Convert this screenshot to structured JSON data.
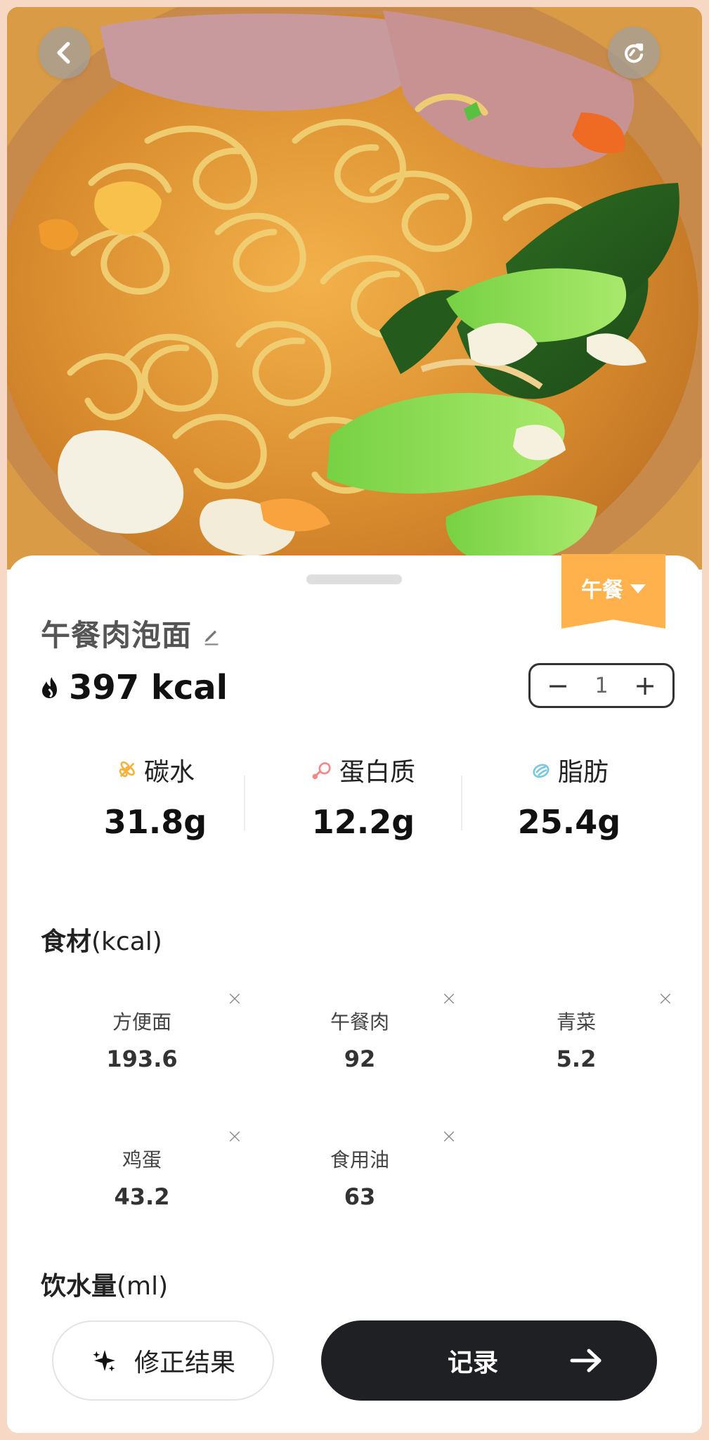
{
  "food": {
    "name": "午餐肉泡面",
    "calories": "397 kcal",
    "meal": "午餐",
    "quantity": "1",
    "edit_icon": "pencil-icon",
    "calorie_icon": "flame-icon"
  },
  "actions": {
    "back_icon": "chevron-left-icon",
    "refresh_icon": "refresh-icon",
    "decrement": "−",
    "increment": "+",
    "correct_label": "修正结果",
    "record_label": "记录"
  },
  "macros": [
    {
      "label": "碳水",
      "value": "31.8g",
      "icon": "grain-icon",
      "color": "#f7b23e"
    },
    {
      "label": "蛋白质",
      "value": "12.2g",
      "icon": "drumstick-icon",
      "color": "#f08a8a"
    },
    {
      "label": "脂肪",
      "value": "25.4g",
      "icon": "oil-icon",
      "color": "#79c7e3"
    }
  ],
  "sections": {
    "ingredients_title": "食材",
    "ingredients_unit": "(kcal)",
    "water_title": "饮水量",
    "water_unit": "(ml)"
  },
  "ingredients": [
    {
      "name": "方便面",
      "value": "193.6",
      "remove": "×"
    },
    {
      "name": "午餐肉",
      "value": "92",
      "remove": "×"
    },
    {
      "name": "青菜",
      "value": "5.2",
      "remove": "×"
    },
    {
      "name": "鸡蛋",
      "value": "43.2",
      "remove": "×"
    },
    {
      "name": "食用油",
      "value": "63",
      "remove": "×"
    }
  ],
  "colors": {
    "accent": "#ffb14b",
    "dark_button": "#1f2024",
    "page_border": "#f7d8c5"
  }
}
